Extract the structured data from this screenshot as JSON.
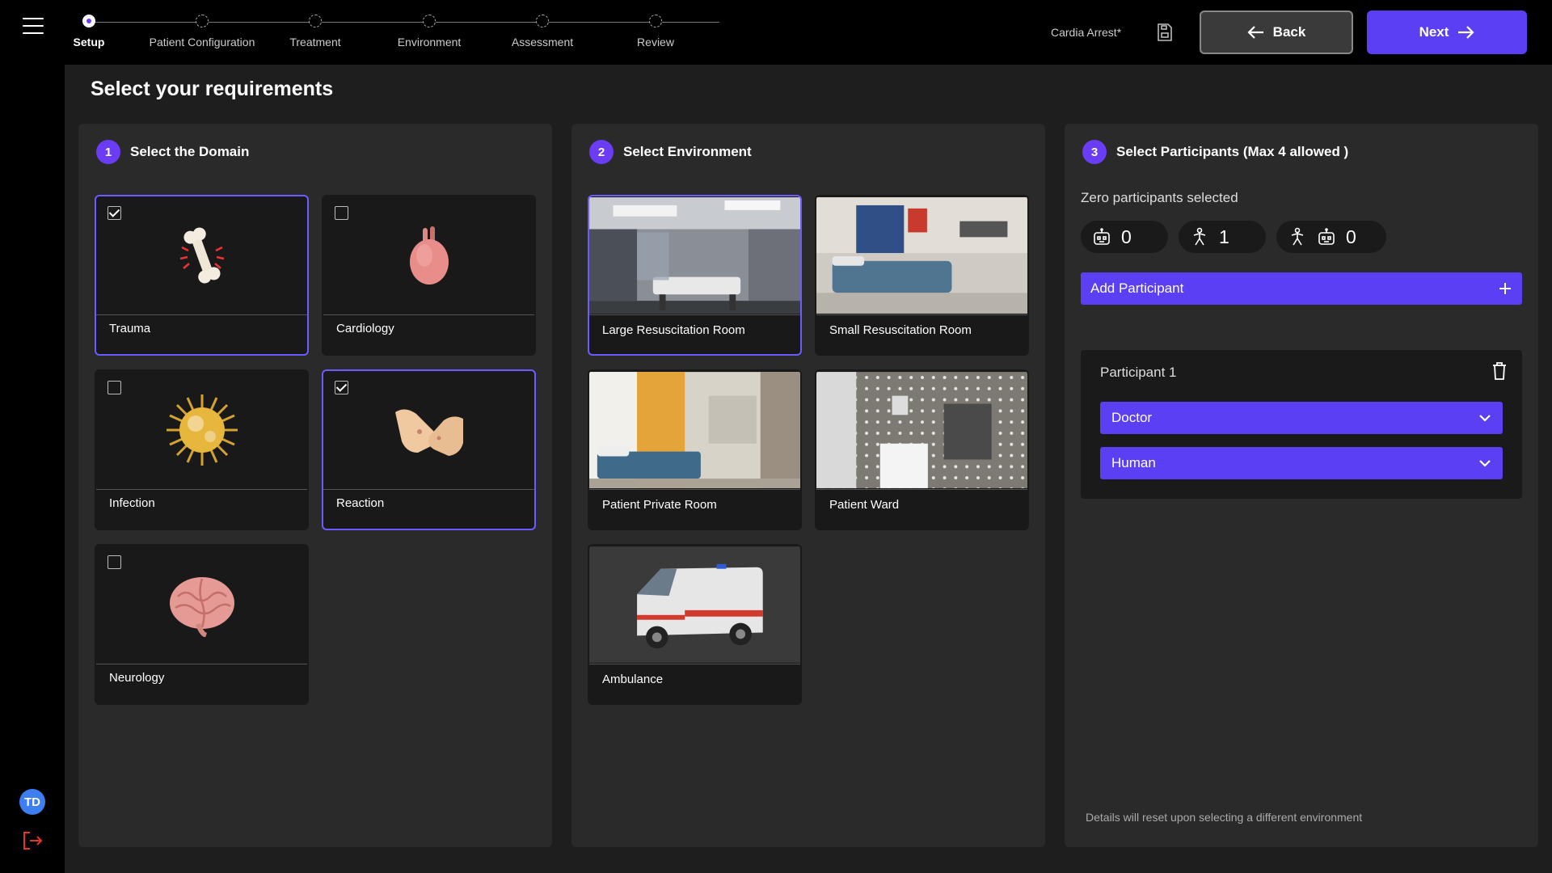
{
  "steps": [
    "Setup",
    "Patient Configuration",
    "Treatment",
    "Environment",
    "Assessment",
    "Review"
  ],
  "active_step": "Setup",
  "header": {
    "scenario_name": "Cardia Arrest*",
    "back_label": "Back",
    "next_label": "Next"
  },
  "page_title": "Select  your requirements",
  "domain": {
    "number": "1",
    "title": "Select the Domain",
    "items": [
      {
        "label": "Trauma",
        "checked": true
      },
      {
        "label": "Cardiology",
        "checked": false
      },
      {
        "label": "Infection",
        "checked": false
      },
      {
        "label": "Reaction",
        "checked": true
      },
      {
        "label": "Neurology",
        "checked": false
      }
    ]
  },
  "environment": {
    "number": "2",
    "title": "Select Environment",
    "items": [
      {
        "label": "Large Resuscitation Room",
        "selected": true
      },
      {
        "label": "Small Resuscitation Room",
        "selected": false
      },
      {
        "label": "Patient Private Room",
        "selected": false
      },
      {
        "label": "Patient Ward",
        "selected": false
      },
      {
        "label": "Ambulance",
        "selected": false
      }
    ]
  },
  "participants": {
    "number": "3",
    "title": "Select Participants (Max 4 allowed )",
    "status": "Zero participants selected",
    "counts": {
      "bot": "0",
      "human": "1",
      "hybrid": "0"
    },
    "add_label": "Add Participant",
    "list": [
      {
        "title": "Participant 1",
        "role": "Doctor",
        "type": "Human"
      }
    ],
    "note": "Details will reset upon selecting a different environment"
  },
  "user_initials": "TD",
  "colors": {
    "accent": "#5b3ff2",
    "selected_border": "#6a5cff",
    "logout": "#e8322e"
  }
}
